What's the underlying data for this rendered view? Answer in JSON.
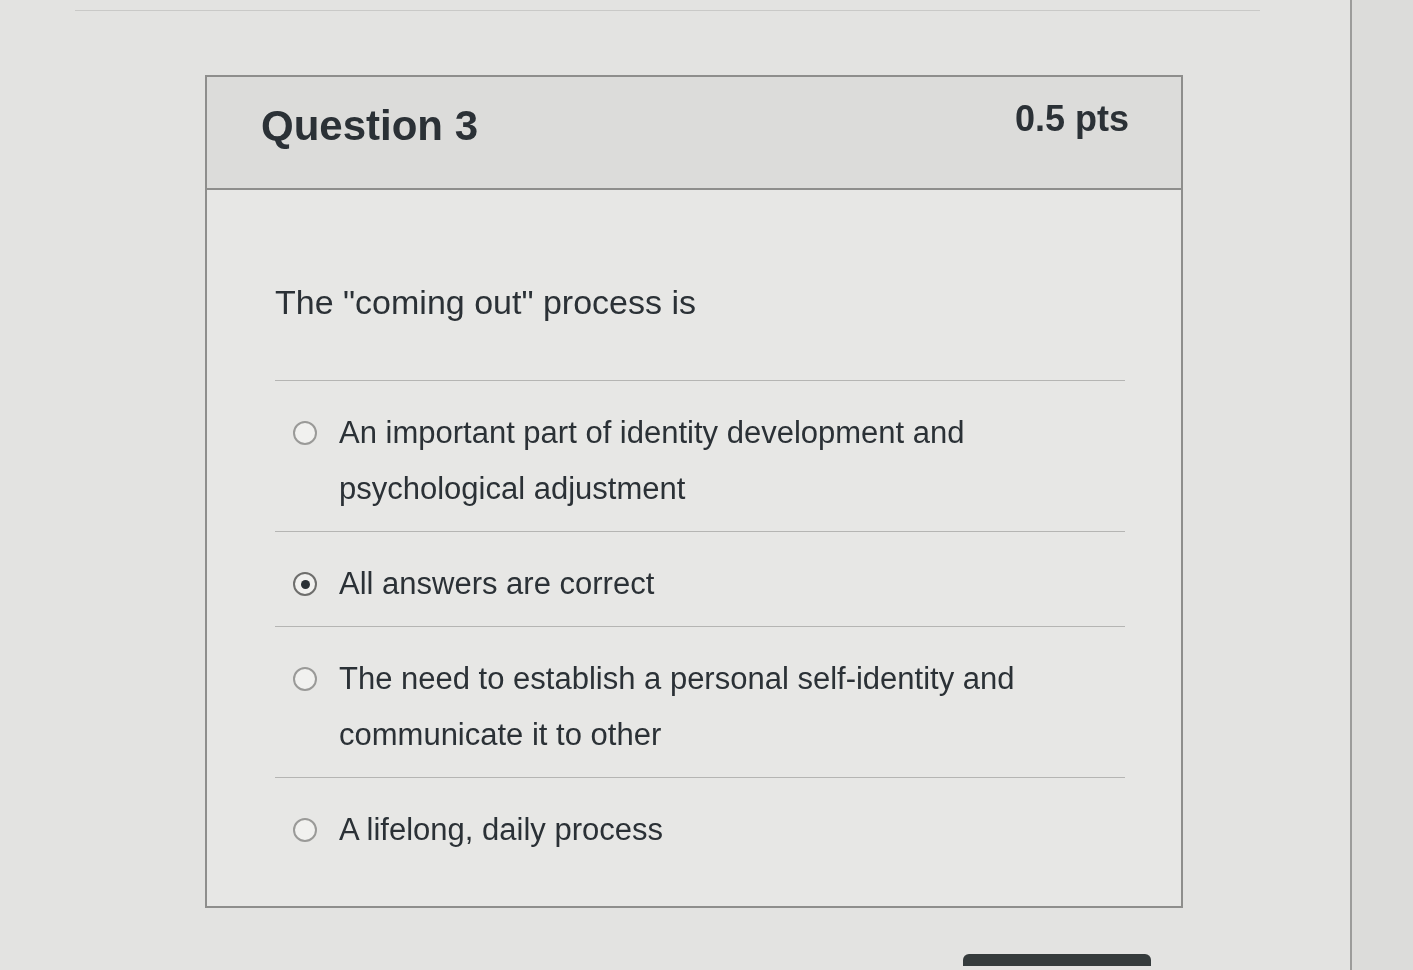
{
  "quiz_question": {
    "title": "Question 3",
    "points": "0.5 pts",
    "prompt": "The \"coming out\" process is",
    "answers": [
      {
        "label": "An important part of identity development and psychological adjustment",
        "selected": false
      },
      {
        "label": "All answers are correct",
        "selected": true
      },
      {
        "label": "The need to establish a personal self-identity and communicate it to other",
        "selected": false
      },
      {
        "label": "A lifelong, daily process",
        "selected": false
      }
    ]
  }
}
